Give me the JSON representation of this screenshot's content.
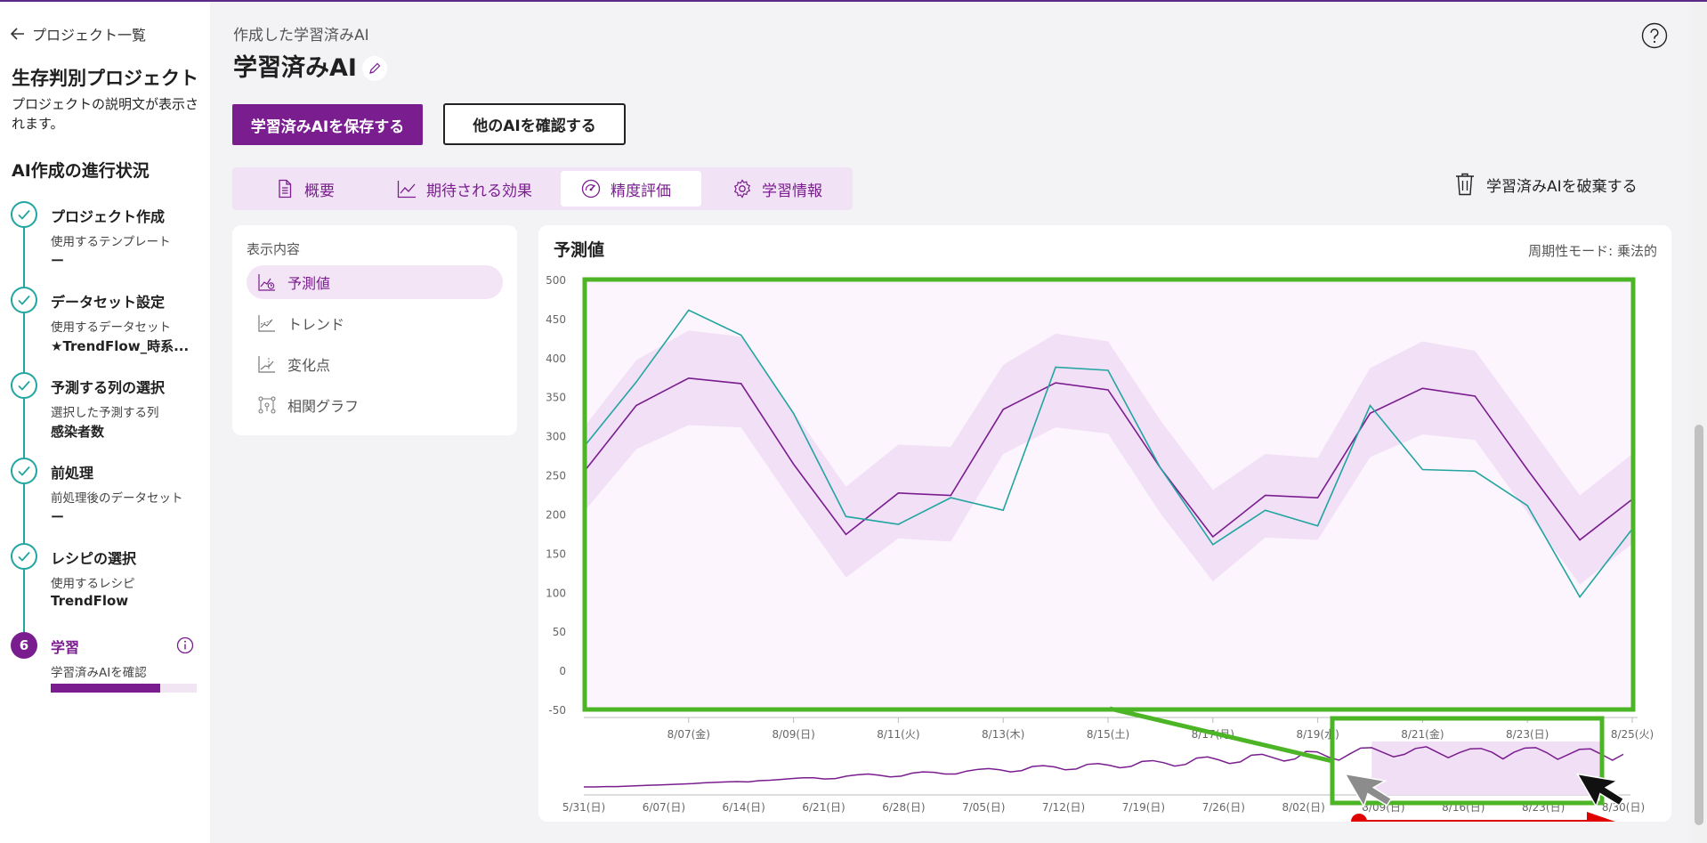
{
  "sidebar": {
    "back_label": "プロジェクト一覧",
    "project_title": "生存判別プロジェクト",
    "project_desc": "プロジェクトの説明文が表示されます。",
    "progress_title": "AI作成の進行状況",
    "steps": [
      {
        "name": "プロジェクト作成",
        "sub": "使用するテンプレート",
        "value": "ー"
      },
      {
        "name": "データセット設定",
        "sub": "使用するデータセット",
        "value": "★TrendFlow_時系..."
      },
      {
        "name": "予測する列の選択",
        "sub": "選択した予測する列",
        "value": "感染者数"
      },
      {
        "name": "前処理",
        "sub": "前処理後のデータセット",
        "value": "ー"
      },
      {
        "name": "レシピの選択",
        "sub": "使用するレシピ",
        "value": "TrendFlow"
      },
      {
        "number": "6",
        "name": "学習",
        "sub": "学習済みAIを確認",
        "progress": 0.75
      }
    ]
  },
  "header": {
    "subtitle": "作成した学習済みAI",
    "title": "学習済みAI",
    "save_button": "学習済みAIを保存する",
    "compare_button": "他のAIを確認する",
    "discard_label": "学習済みAIを破棄する"
  },
  "tabs": [
    {
      "label": "概要",
      "icon": "document-icon"
    },
    {
      "label": "期待される効果",
      "icon": "line-chart-icon"
    },
    {
      "label": "精度評価",
      "icon": "gauge-icon",
      "active": true
    },
    {
      "label": "学習情報",
      "icon": "gear-icon"
    }
  ],
  "display_panel": {
    "label": "表示内容",
    "items": [
      {
        "label": "予測値",
        "active": true
      },
      {
        "label": "トレンド"
      },
      {
        "label": "変化点"
      },
      {
        "label": "相関グラフ"
      }
    ]
  },
  "chart": {
    "title": "予測値",
    "mode_label": "周期性モード: 乗法的"
  },
  "colors": {
    "accent": "#7a1d8f",
    "teal": "#22a5a0",
    "band": "#f0dcf4",
    "highlight_box": "#4cb526",
    "arrow": "#e00000"
  },
  "chart_data": [
    {
      "type": "line",
      "title": "予測値",
      "ylim": [
        -50,
        500
      ],
      "yticks": [
        -50,
        0,
        50,
        100,
        150,
        200,
        250,
        300,
        350,
        400,
        450,
        500
      ],
      "xlim": [
        "8/05",
        "8/26"
      ],
      "xticks": [
        "8/07(金)",
        "8/09(日)",
        "8/11(火)",
        "8/13(木)",
        "8/15(土)",
        "8/17(月)",
        "8/19(水)",
        "8/21(金)",
        "8/23(日)",
        "8/25(火)"
      ],
      "x": [
        "8/05",
        "8/06",
        "8/07",
        "8/08",
        "8/09",
        "8/10",
        "8/11",
        "8/12",
        "8/13",
        "8/14",
        "8/15",
        "8/16",
        "8/17",
        "8/18",
        "8/19",
        "8/20",
        "8/21",
        "8/22",
        "8/23",
        "8/24",
        "8/25"
      ],
      "series": [
        {
          "values": [
            255,
            340,
            375,
            368,
            265,
            175,
            228,
            225,
            335,
            369,
            360,
            260,
            172,
            225,
            222,
            330,
            362,
            352,
            258,
            168,
            220
          ]
        },
        {
          "values": [
            287,
            370,
            462,
            430,
            330,
            198,
            188,
            222,
            206,
            389,
            385,
            260,
            162,
            206,
            186,
            340,
            258,
            256,
            212,
            95,
            182
          ]
        }
      ],
      "band_upper": [
        312,
        398,
        436,
        428,
        332,
        236,
        290,
        287,
        392,
        432,
        422,
        321,
        232,
        278,
        273,
        388,
        422,
        410,
        318,
        225,
        278
      ],
      "band_lower": [
        204,
        284,
        315,
        312,
        214,
        120,
        170,
        166,
        278,
        312,
        304,
        202,
        115,
        171,
        168,
        274,
        303,
        296,
        203,
        111,
        163
      ]
    },
    {
      "type": "line",
      "xticks": [
        "5/31(日)",
        "6/07(日)",
        "6/14(日)",
        "6/21(日)",
        "6/28(日)",
        "7/05(日)",
        "7/12(日)",
        "7/19(日)",
        "7/26(日)",
        "8/02(日)",
        "8/09(日)",
        "8/16(日)",
        "8/23(日)",
        "8/30(日)"
      ],
      "selected_range": [
        "8/05",
        "8/26"
      ],
      "values": [
        2,
        2,
        3,
        3,
        4,
        5,
        6,
        7,
        8,
        9,
        10,
        12,
        13,
        14,
        15,
        14,
        17,
        18,
        20,
        22,
        24,
        24,
        21,
        22,
        28,
        31,
        33,
        30,
        26,
        28,
        35,
        38,
        37,
        33,
        33,
        40,
        44,
        46,
        43,
        38,
        41,
        51,
        53,
        50,
        43,
        45,
        56,
        58,
        54,
        48,
        51,
        63,
        65,
        60,
        52,
        56,
        71,
        74,
        67,
        58,
        62,
        78,
        80,
        72,
        64,
        69,
        87,
        86,
        74,
        66,
        81,
        95,
        96,
        85,
        74,
        80,
        94,
        98,
        85,
        72,
        84,
        93,
        94,
        85,
        69,
        85,
        95,
        96,
        84,
        68,
        80,
        92,
        93,
        80,
        66,
        80
      ]
    }
  ]
}
